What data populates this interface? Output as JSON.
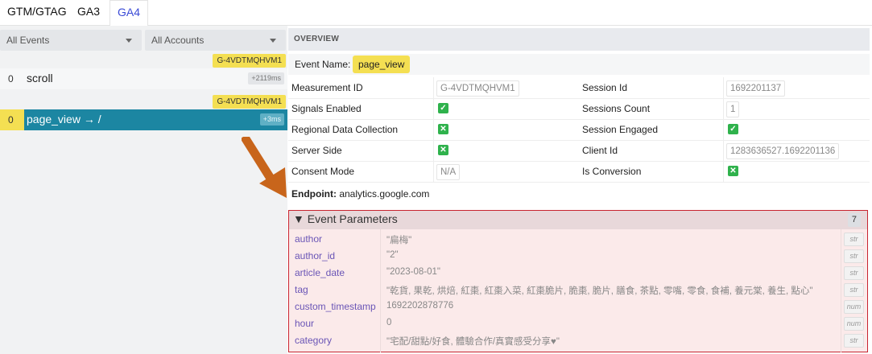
{
  "tabs": [
    "GTM/GTAG",
    "GA3",
    "GA4"
  ],
  "filters": {
    "events": "All Events",
    "accounts": "All Accounts"
  },
  "events": [
    {
      "tid": "G-4VDTMQHVM1",
      "num": "0",
      "name": "scroll",
      "time": "+2119ms"
    },
    {
      "tid": "G-4VDTMQHVM1",
      "num": "0",
      "name": "page_view → /",
      "time": "+3ms"
    }
  ],
  "overview": {
    "header": "OVERVIEW",
    "event_name_label": "Event Name:",
    "event_name_value": "page_view",
    "rows": [
      {
        "k1": "Measurement ID",
        "v1": "G-4VDTMQHVM1",
        "k2": "Session Id",
        "v2": "1692201137"
      },
      {
        "k1": "Signals Enabled",
        "v1": "check",
        "k2": "Sessions Count",
        "v2": "1"
      },
      {
        "k1": "Regional Data Collection",
        "v1": "cross",
        "k2": "Session Engaged",
        "v2": "check"
      },
      {
        "k1": "Server Side",
        "v1": "cross",
        "k2": "Client Id",
        "v2": "1283636527.1692201136"
      },
      {
        "k1": "Consent Mode",
        "v1": "N/A",
        "k2": "Is Conversion",
        "v2": "cross"
      }
    ],
    "endpoint_label": "Endpoint:",
    "endpoint_value": "analytics.google.com"
  },
  "params": {
    "title": "▼ Event Parameters",
    "count": "7",
    "rows": [
      {
        "k": "author",
        "v": "\"扁梅\"",
        "t": "str"
      },
      {
        "k": "author_id",
        "v": "\"2\"",
        "t": "str"
      },
      {
        "k": "article_date",
        "v": "\"2023-08-01\"",
        "t": "str"
      },
      {
        "k": "tag",
        "v": "\"乾貨, 果乾, 烘焙, 紅棗, 紅棗入菜, 紅棗脆片, 脆棗, 脆片, 膳食, 茶點, 零嘴, 零食, 食補, 養元棠, 養生, 點心\"",
        "t": "str"
      },
      {
        "k": "custom_timestamp",
        "v": "1692202878776",
        "t": "num"
      },
      {
        "k": "hour",
        "v": "0",
        "t": "num"
      },
      {
        "k": "category",
        "v": "\"宅配/甜點/好食, 體驗合作/真實感受分享♥\"",
        "t": "str"
      }
    ]
  },
  "colors": {
    "accent_yellow": "#f4df52",
    "selected_row": "#1c86a2",
    "check_green": "#2fb24c",
    "params_border": "#c8242f",
    "arrow": "#c8651b"
  }
}
